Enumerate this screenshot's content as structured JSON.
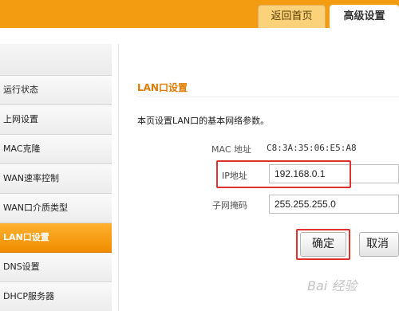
{
  "header": {
    "tabs": [
      {
        "label": "返回首页"
      },
      {
        "label": "高级设置"
      }
    ]
  },
  "sidebar": {
    "items": [
      {
        "label": "运行状态"
      },
      {
        "label": "上网设置"
      },
      {
        "label": "MAC克隆"
      },
      {
        "label": "WAN速率控制"
      },
      {
        "label": "WAN口介质类型"
      },
      {
        "label": "LAN口设置",
        "active": true
      },
      {
        "label": "DNS设置"
      },
      {
        "label": "DHCP服务器"
      }
    ]
  },
  "main": {
    "title": "LAN口设置",
    "description": "本页设置LAN口的基本网络参数。",
    "mac": {
      "label": "MAC 地址",
      "value": "C8:3A:35:06:E5:A8"
    },
    "ip": {
      "label": "IP地址",
      "value": "192.168.0.1"
    },
    "mask": {
      "label": "子网掩码",
      "value": "255.255.255.0"
    },
    "buttons": {
      "ok": "确定",
      "cancel": "取消"
    }
  },
  "watermark": "Bai 经验",
  "colors": {
    "accent": "#f39c12",
    "active_item": "#f08c00",
    "title": "#e07b00",
    "highlight": "#e0312f"
  }
}
